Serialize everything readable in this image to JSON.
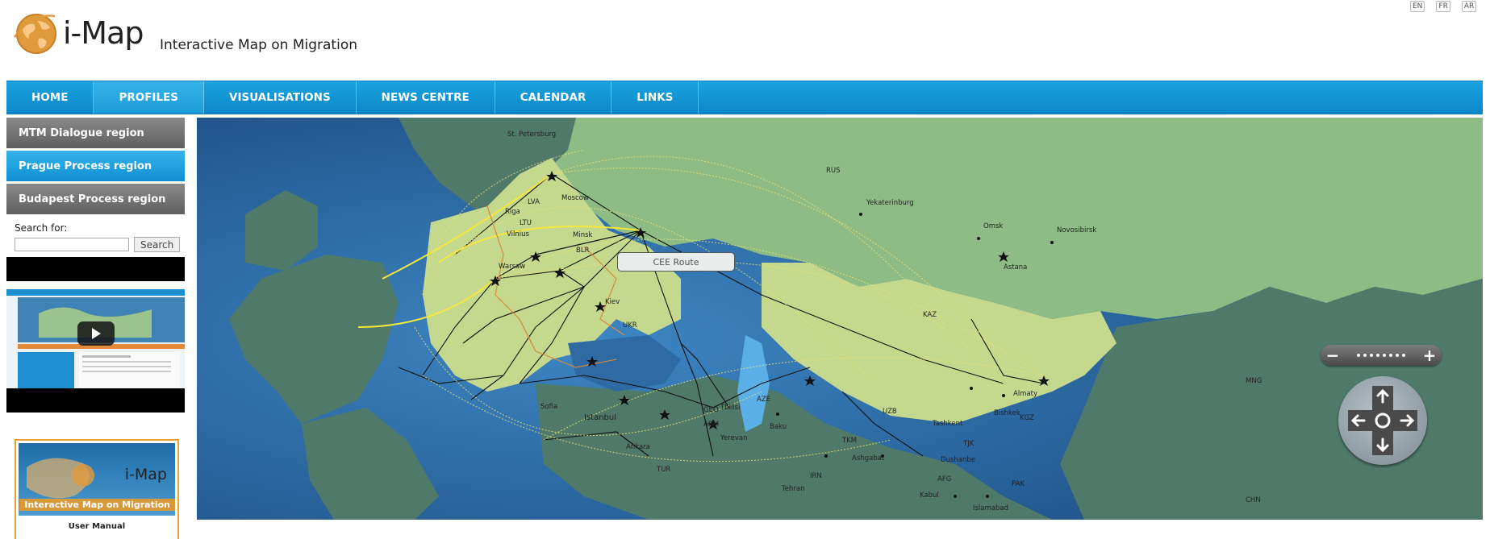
{
  "header": {
    "logo_text": "i-Map",
    "tagline": "Interactive Map on Migration",
    "languages": [
      "EN",
      "FR",
      "AR"
    ]
  },
  "nav": {
    "items": [
      {
        "label": "HOME"
      },
      {
        "label": "PROFILES"
      },
      {
        "label": "VISUALISATIONS"
      },
      {
        "label": "NEWS CENTRE"
      },
      {
        "label": "CALENDAR"
      },
      {
        "label": "LINKS"
      }
    ],
    "active": "PROFILES"
  },
  "sidebar": {
    "regions": [
      {
        "label": "MTM Dialogue region"
      },
      {
        "label": "Prague Process region"
      },
      {
        "label": "Budapest Process region"
      }
    ],
    "active_region": "Prague Process region",
    "search_label": "Search for:",
    "search_value": "",
    "search_button": "Search",
    "manual": {
      "title": "i-Map",
      "subtitle": "Interactive Map on Migration",
      "label": "User Manual"
    }
  },
  "map": {
    "route_label": "CEE Route",
    "cities": [
      {
        "name": "St. Petersburg"
      },
      {
        "name": "Moscow"
      },
      {
        "name": "Yekaterinburg"
      },
      {
        "name": "Omsk"
      },
      {
        "name": "Novosibirsk"
      },
      {
        "name": "Astana"
      },
      {
        "name": "Minsk"
      },
      {
        "name": "Warsaw"
      },
      {
        "name": "Riga"
      },
      {
        "name": "Vilnius"
      },
      {
        "name": "Kiev"
      },
      {
        "name": "Sofia"
      },
      {
        "name": "Istanbul"
      },
      {
        "name": "Ankara"
      },
      {
        "name": "Tbilisi"
      },
      {
        "name": "Yerevan"
      },
      {
        "name": "Baku"
      },
      {
        "name": "Tehran"
      },
      {
        "name": "Ashgabat"
      },
      {
        "name": "Tashkent"
      },
      {
        "name": "Bishkek"
      },
      {
        "name": "Almaty"
      },
      {
        "name": "Dushanbe"
      },
      {
        "name": "Kabul"
      },
      {
        "name": "Islamabad"
      }
    ],
    "country_codes": [
      "RUS",
      "UKR",
      "KAZ",
      "UZB",
      "TKM",
      "TJK",
      "KGZ",
      "BLR",
      "LTU",
      "LVA",
      "TUR",
      "IRN",
      "AFG",
      "PAK",
      "CHN",
      "MNG",
      "AZE",
      "GEO",
      "ARM"
    ],
    "colors": {
      "sea": "#2f6aa3",
      "region_highlight": "#c4d88e",
      "land": "#8dbd85",
      "dark_land": "#4f7a6a",
      "route_line": "#111111",
      "flow_line": "#f0e070"
    },
    "controls": {
      "zoom_in": "+",
      "zoom_out": "−"
    }
  }
}
